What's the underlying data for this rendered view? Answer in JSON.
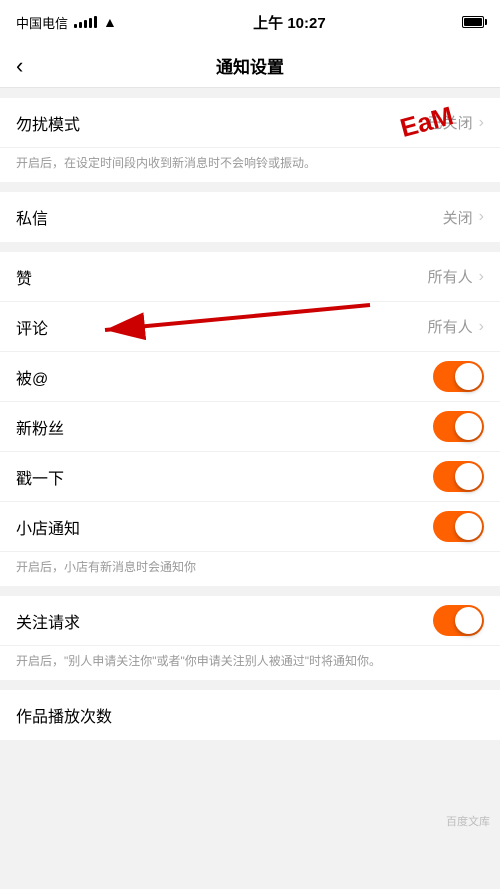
{
  "statusBar": {
    "carrier": "中国电信",
    "time": "上午 10:27"
  },
  "navBar": {
    "back": "<",
    "title": "通知设置"
  },
  "rows": [
    {
      "id": "dnd",
      "label": "勿扰模式",
      "valueText": "已关闭",
      "type": "link",
      "hasChevron": true
    },
    {
      "id": "dnd-desc",
      "type": "desc",
      "text": "开启后，在设定时间段内收到新消息时不会响铃或振动。"
    },
    {
      "id": "private-msg",
      "label": "私信",
      "valueText": "关闭",
      "type": "link",
      "hasChevron": true
    },
    {
      "id": "like",
      "label": "赞",
      "valueText": "所有人",
      "type": "link",
      "hasChevron": true
    },
    {
      "id": "comment",
      "label": "评论",
      "valueText": "所有人",
      "type": "link",
      "hasChevron": true
    },
    {
      "id": "at",
      "label": "被@",
      "type": "toggle",
      "toggleOn": true
    },
    {
      "id": "new-fans",
      "label": "新粉丝",
      "type": "toggle",
      "toggleOn": true
    },
    {
      "id": "game",
      "label": "戳一下",
      "type": "toggle",
      "toggleOn": true
    },
    {
      "id": "shop-notify",
      "label": "小店通知",
      "type": "toggle",
      "toggleOn": true
    },
    {
      "id": "shop-desc",
      "type": "desc",
      "text": "开启后，小店有新消息时会通知你"
    },
    {
      "id": "follow-req",
      "label": "关注请求",
      "type": "toggle",
      "toggleOn": true
    },
    {
      "id": "follow-desc",
      "type": "desc",
      "text": "开启后，\"别人申请关注你\"或者\"你申请关注别人被通过\"时将通知你。"
    },
    {
      "id": "play-count",
      "label": "作品播放次数",
      "type": "link",
      "hasChevron": false
    }
  ],
  "colors": {
    "orange": "#FF6000",
    "arrowRed": "#CC0000"
  }
}
